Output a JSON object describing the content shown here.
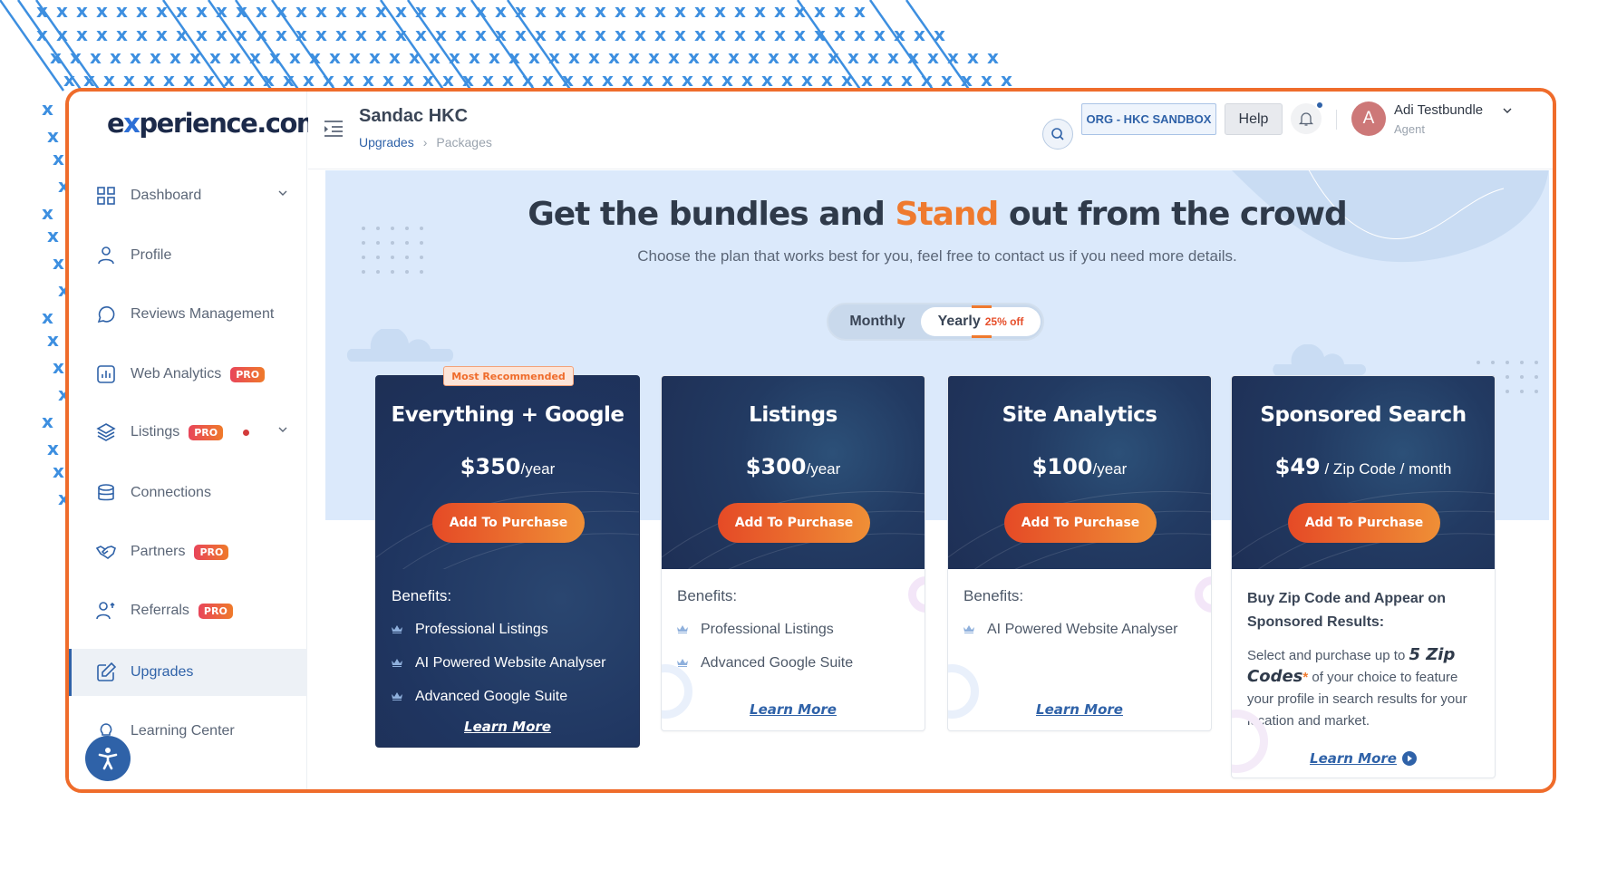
{
  "app": {
    "logo_text_pre": "e",
    "logo_text_x": "x",
    "logo_text_post": "perience.com"
  },
  "sidebar": {
    "items": [
      {
        "label": "Dashboard",
        "icon": "dashboard-grid-icon",
        "has_chevron": true
      },
      {
        "label": "Profile",
        "icon": "user-icon"
      },
      {
        "label": "Reviews Management",
        "icon": "chat-bubble-icon"
      },
      {
        "label": "Web Analytics",
        "icon": "bar-chart-icon",
        "badge": "PRO"
      },
      {
        "label": "Listings",
        "icon": "layers-icon",
        "badge": "PRO",
        "has_dot": true,
        "has_chevron": true
      },
      {
        "label": "Connections",
        "icon": "database-icon"
      },
      {
        "label": "Partners",
        "icon": "handshake-icon",
        "badge": "PRO"
      },
      {
        "label": "Referrals",
        "icon": "user-referral-icon",
        "badge": "PRO"
      },
      {
        "label": "Upgrades",
        "icon": "edit-square-icon",
        "active": true
      },
      {
        "label": "Learning Center",
        "icon": "lightbulb-icon"
      }
    ],
    "accessibility_button": "accessibility-icon"
  },
  "header": {
    "title": "Sandac HKC",
    "breadcrumb": [
      "Upgrades",
      "Packages"
    ],
    "org_badge": "ORG - HKC SANDBOX",
    "help_label": "Help",
    "user": {
      "initial": "A",
      "name": "Adi Testbundle",
      "role": "Agent"
    },
    "notification_dot": true
  },
  "hero": {
    "title_pre": "Get the bundles and ",
    "title_accent": "Stand",
    "title_post": " out from the crowd",
    "subtitle": "Choose the plan that works best for you, feel free to contact us if you need more details.",
    "toggle": {
      "monthly": "Monthly",
      "yearly": "Yearly",
      "yearly_discount": "25% off",
      "selected": "Yearly"
    }
  },
  "colors": {
    "accent_orange": "#ef6c2b",
    "brand_blue": "#2f62a8",
    "card_navy": "#1e2f55",
    "hero_bg": "#dbe9fb"
  },
  "plans": [
    {
      "name": "Everything + Google",
      "price": "$350",
      "period": "/year",
      "badge": "Most Recommended",
      "button": "Add To Purchase",
      "benefits_title": "Benefits:",
      "benefits": [
        "Professional Listings",
        "AI Powered Website Analyser",
        "Advanced Google Suite"
      ],
      "learn_more": "Learn More"
    },
    {
      "name": "Listings",
      "price": "$300",
      "period": "/year",
      "button": "Add To Purchase",
      "benefits_title": "Benefits:",
      "benefits": [
        "Professional Listings",
        "Advanced Google Suite"
      ],
      "learn_more": "Learn More"
    },
    {
      "name": "Site Analytics",
      "price": "$100",
      "period": "/year",
      "button": "Add To Purchase",
      "benefits_title": "Benefits:",
      "benefits": [
        "AI Powered Website Analyser"
      ],
      "learn_more": "Learn More"
    },
    {
      "name": "Sponsored Search",
      "price": "$49",
      "period": " / Zip Code / month",
      "button": "Add To Purchase",
      "heading": "Buy Zip Code and Appear on Sponsored Results:",
      "desc_pre": "Select and purchase up to ",
      "desc_highlight": "5 Zip Codes",
      "desc_asterisk": "*",
      "desc_post": " of your choice to feature your profile in search results for your location and market.",
      "learn_more": "Learn More"
    }
  ]
}
